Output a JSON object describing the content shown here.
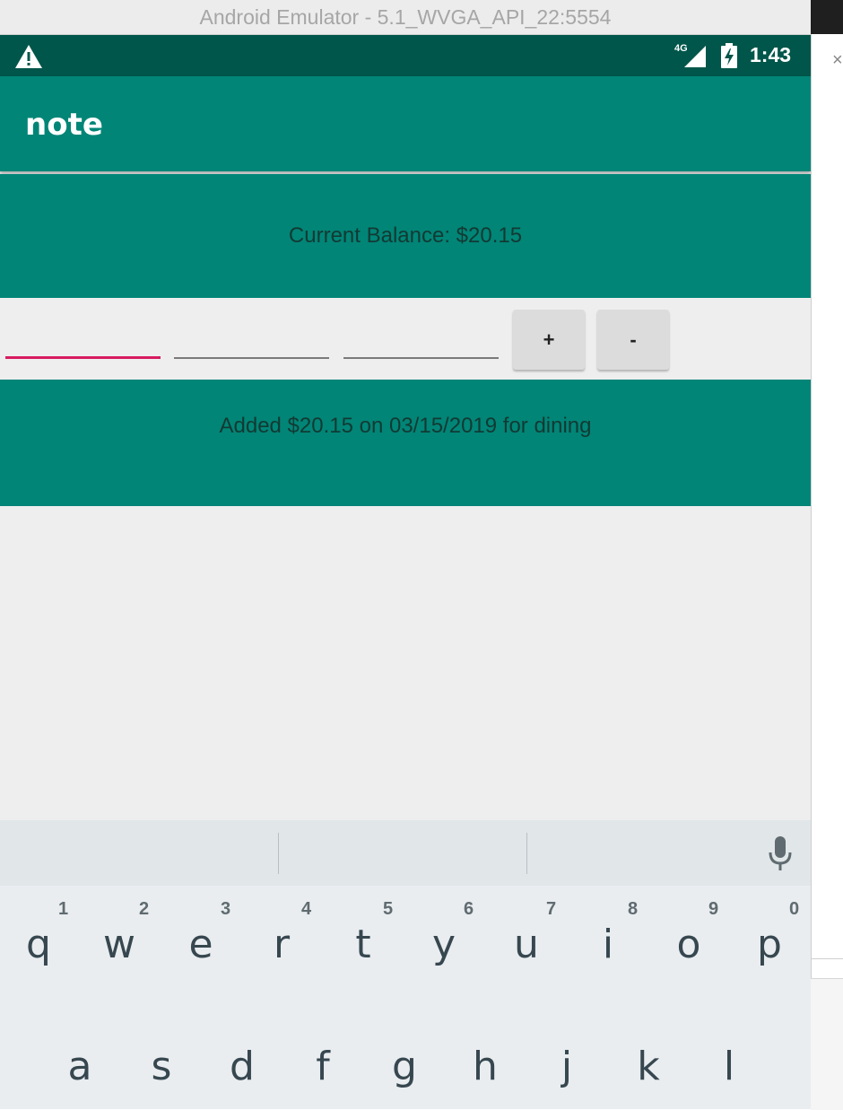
{
  "window": {
    "title": "Android Emulator - 5.1_WVGA_API_22:5554",
    "side_close_glyph": "×"
  },
  "status_bar": {
    "warning_icon": "warning-triangle-icon",
    "network_label": "4G",
    "signal_icon": "cell-signal-icon",
    "battery_icon": "battery-charging-icon",
    "time": "1:43"
  },
  "app_bar": {
    "title": "note"
  },
  "balance": {
    "text": "Current Balance: $20.15"
  },
  "inputs": {
    "amount": {
      "value": ""
    },
    "date": {
      "value": ""
    },
    "category": {
      "value": ""
    }
  },
  "buttons": {
    "add_label": "+",
    "subtract_label": "-"
  },
  "history": {
    "entries": [
      "Added $20.15 on 03/15/2019 for dining"
    ]
  },
  "keyboard": {
    "mic_icon": "microphone-icon",
    "row1": [
      {
        "letter": "q",
        "hint": "1"
      },
      {
        "letter": "w",
        "hint": "2"
      },
      {
        "letter": "e",
        "hint": "3"
      },
      {
        "letter": "r",
        "hint": "4"
      },
      {
        "letter": "t",
        "hint": "5"
      },
      {
        "letter": "y",
        "hint": "6"
      },
      {
        "letter": "u",
        "hint": "7"
      },
      {
        "letter": "i",
        "hint": "8"
      },
      {
        "letter": "o",
        "hint": "9"
      },
      {
        "letter": "p",
        "hint": "0"
      }
    ],
    "row2": [
      "a",
      "s",
      "d",
      "f",
      "g",
      "h",
      "j",
      "k",
      "l"
    ]
  },
  "colors": {
    "status_bar": "#00564a",
    "primary": "#018577",
    "accent": "#d81b60",
    "background": "#eeeeee",
    "keyboard": "#e9edf0"
  }
}
